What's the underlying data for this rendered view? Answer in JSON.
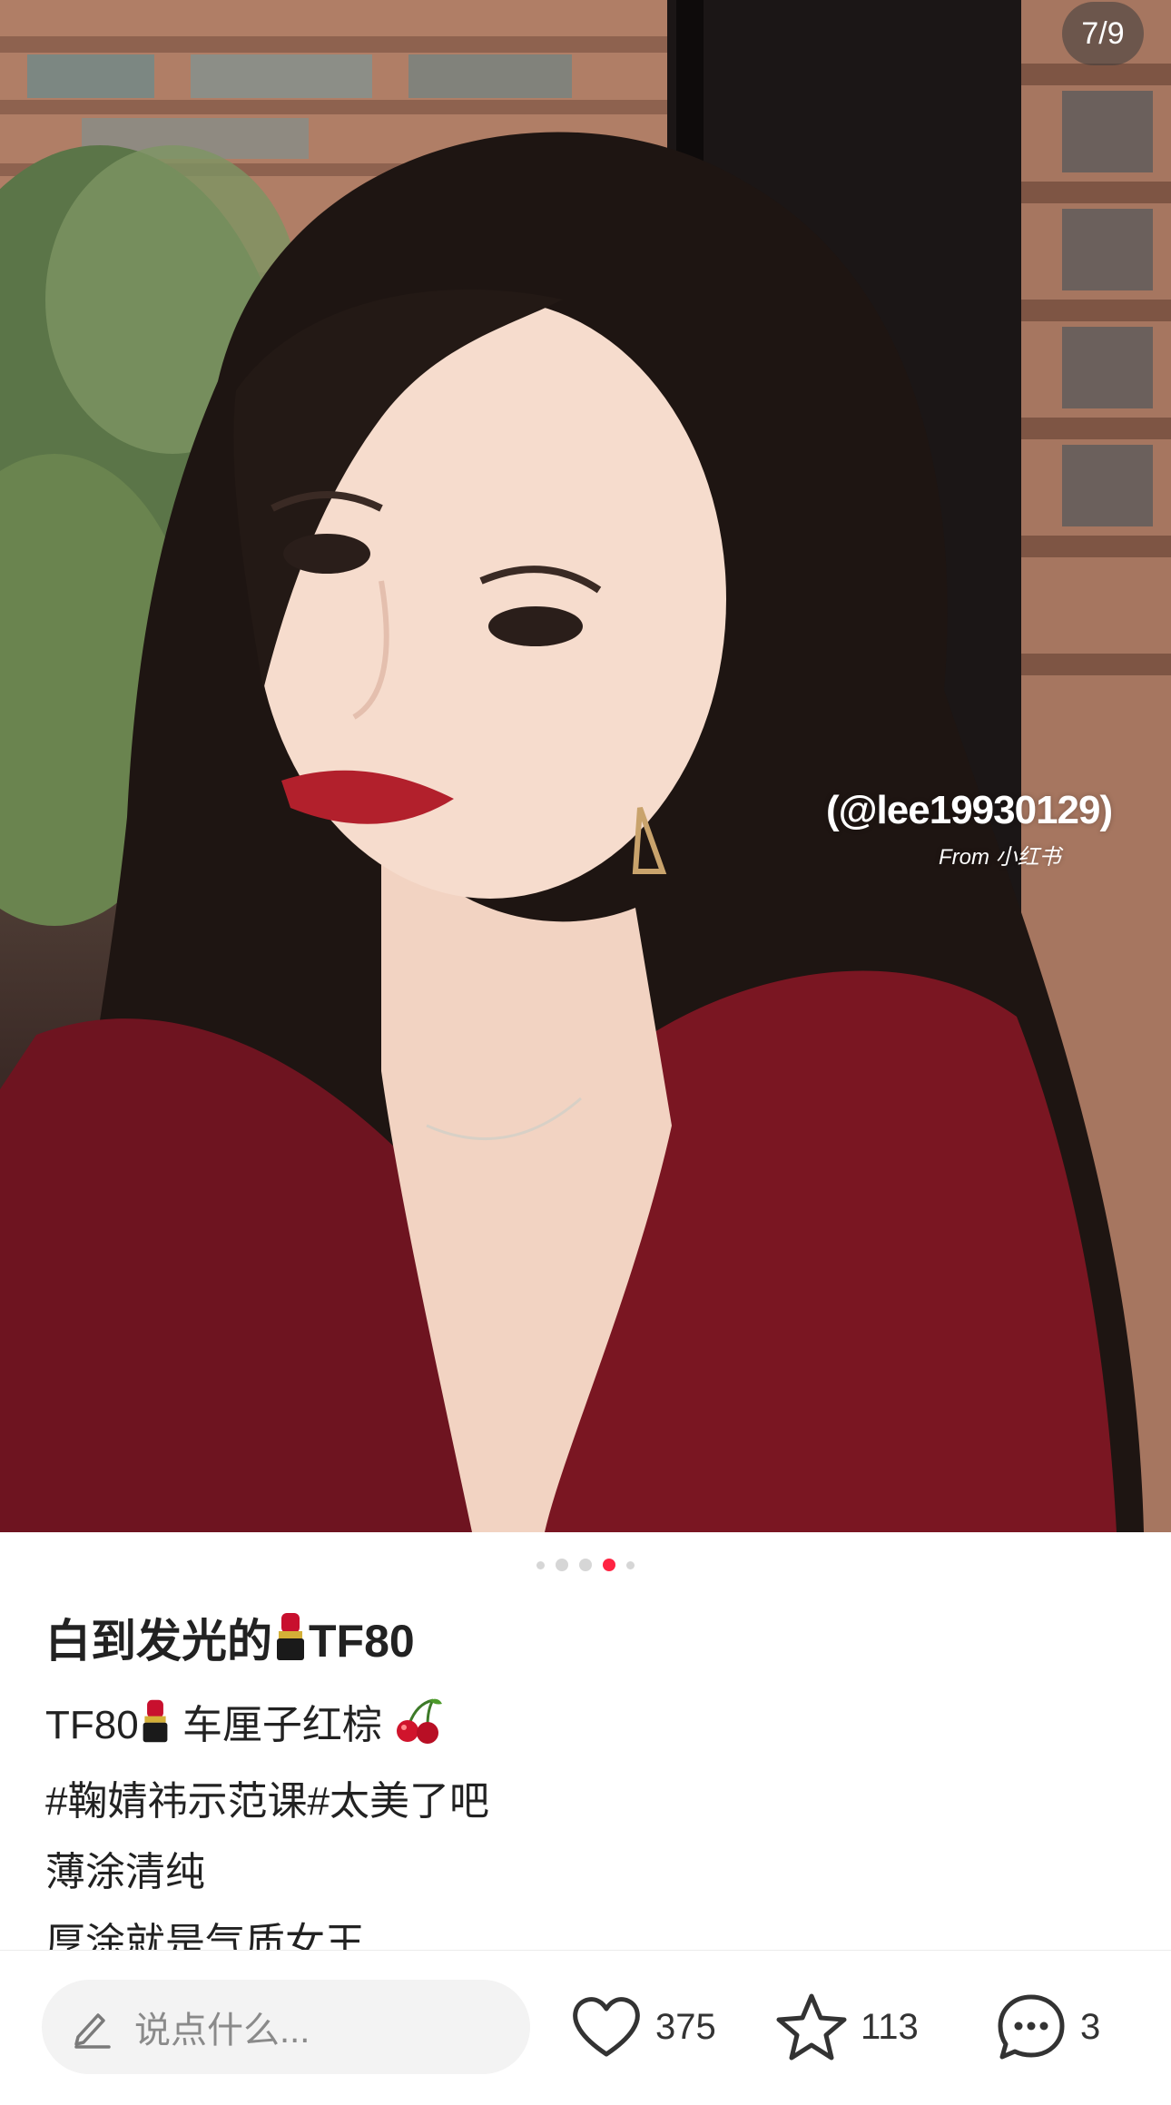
{
  "photo": {
    "counter": "7/9",
    "watermark_handle": "(@lee19930129)",
    "watermark_source": "From 小红书"
  },
  "carousel": {
    "dot_count": 5,
    "active_index": 3
  },
  "post": {
    "title": "白到发光的",
    "title_suffix": "TF80",
    "lines": [
      {
        "before": "TF80",
        "after": "车厘子红棕"
      },
      {
        "text": "#鞠婧祎示范课#太美了吧"
      },
      {
        "text": "薄涂清纯"
      },
      {
        "text": "厚涂就是气质女王"
      }
    ]
  },
  "bottom_bar": {
    "comment_placeholder": "说点什么...",
    "likes": "375",
    "collects": "113",
    "comments": "3"
  },
  "colors": {
    "accent": "#ff2442",
    "text": "#222222",
    "placeholder": "#8a8a8a",
    "input_bg": "#f3f3f3"
  },
  "icons": [
    "lipstick-emoji",
    "cherry-emoji",
    "pen-icon",
    "heart-icon",
    "star-icon",
    "comment-bubble-icon"
  ]
}
